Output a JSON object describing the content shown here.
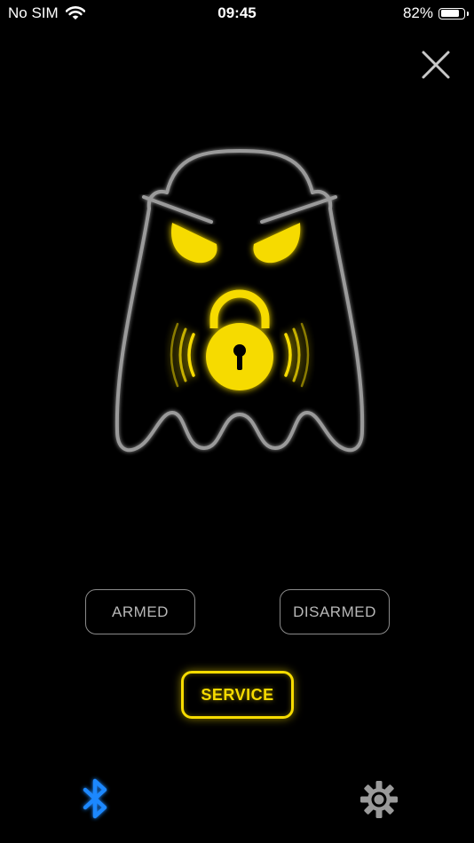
{
  "status_bar": {
    "carrier": "No SIM",
    "time": "09:45",
    "battery_percent": "82%",
    "battery_level": 0.82,
    "wifi_icon": "wifi-icon"
  },
  "header": {
    "close_icon": "close-icon"
  },
  "illustration": {
    "icon": "ghost-lock-icon",
    "ghost_outline_color": "#9a9a9a",
    "accent_color": "#f6db00"
  },
  "modes": {
    "armed_label": "ARMED",
    "disarmed_label": "DISARMED",
    "service_label": "SERVICE",
    "active": "SERVICE"
  },
  "bottom_bar": {
    "bluetooth_icon": "bluetooth-icon",
    "bluetooth_color": "#1e88ff",
    "settings_icon": "gear-icon"
  }
}
